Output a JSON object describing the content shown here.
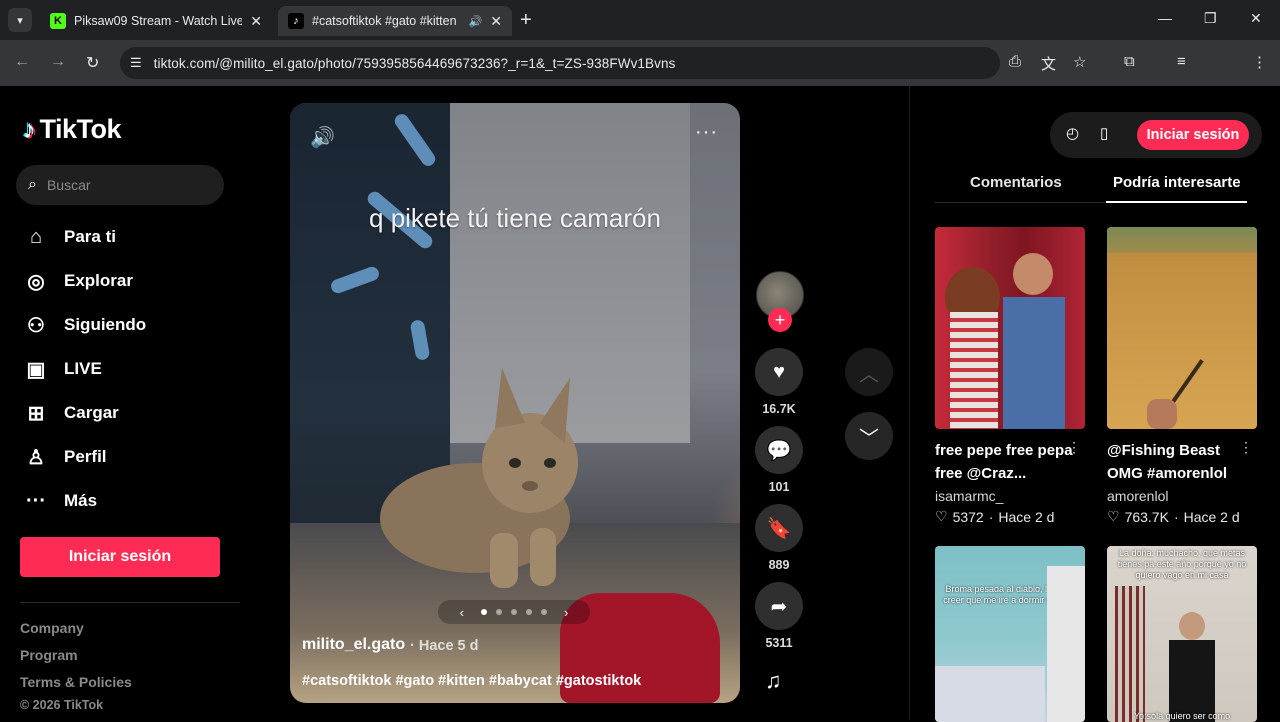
{
  "browser": {
    "tabs": [
      {
        "title": "Piksaw09 Stream - Watch Live o",
        "active": false
      },
      {
        "title": "#catsoftiktok #gato #kitten",
        "active": true
      }
    ],
    "url": "tiktok.com/@milito_el.gato/photo/7593958564469673236?_r=1&_t=ZS-938FWv1Bvns"
  },
  "sidebar": {
    "logo": "TikTok",
    "search_placeholder": "Buscar",
    "nav": [
      {
        "label": "Para ti",
        "icon": "home-icon"
      },
      {
        "label": "Explorar",
        "icon": "compass-icon"
      },
      {
        "label": "Siguiendo",
        "icon": "following-icon"
      },
      {
        "label": "LIVE",
        "icon": "live-icon"
      },
      {
        "label": "Cargar",
        "icon": "upload-icon"
      },
      {
        "label": "Perfil",
        "icon": "profile-icon"
      },
      {
        "label": "Más",
        "icon": "more-icon"
      }
    ],
    "login": "Iniciar sesión",
    "footer": [
      "Company",
      "Program",
      "Terms & Policies"
    ],
    "copyright": "© 2026 TikTok"
  },
  "post": {
    "caption_overlay": "q pikete tú tiene camarón",
    "author": "milito_el.gato",
    "time": "· Hace 5 d",
    "hashtags": "#catsoftiktok #gato #kitten #babycat #gatostiktok",
    "slides_total": 5,
    "slide_current": 1,
    "likes": "16.7K",
    "comments": "101",
    "saves": "889",
    "shares": "5311"
  },
  "right_panel": {
    "login": "Iniciar sesión",
    "tabs": [
      "Comentarios",
      "Podría interesarte"
    ],
    "active_tab": "Podría interesarte",
    "cards": [
      {
        "title": "free pepe free pepa free @Craz...",
        "user": "isamarmc_",
        "likes": "5372",
        "time": "Hace 2 d"
      },
      {
        "title": "@Fishing Beast OMG #amorenlol",
        "user": "amorenlol",
        "likes": "763.7K",
        "time": "Hace 2 d"
      },
      {
        "overlay": "Broma pesada al diablo, le hago creer que me iré a dormir sin orar"
      },
      {
        "overlay": "La doña: muchacho, que metas tienes pa este año porque yo no quiero vago en mi casa",
        "bottom": "Yo:sola quiero ser como"
      }
    ]
  },
  "colors": {
    "accent": "#fe2c55",
    "background": "#000000"
  }
}
